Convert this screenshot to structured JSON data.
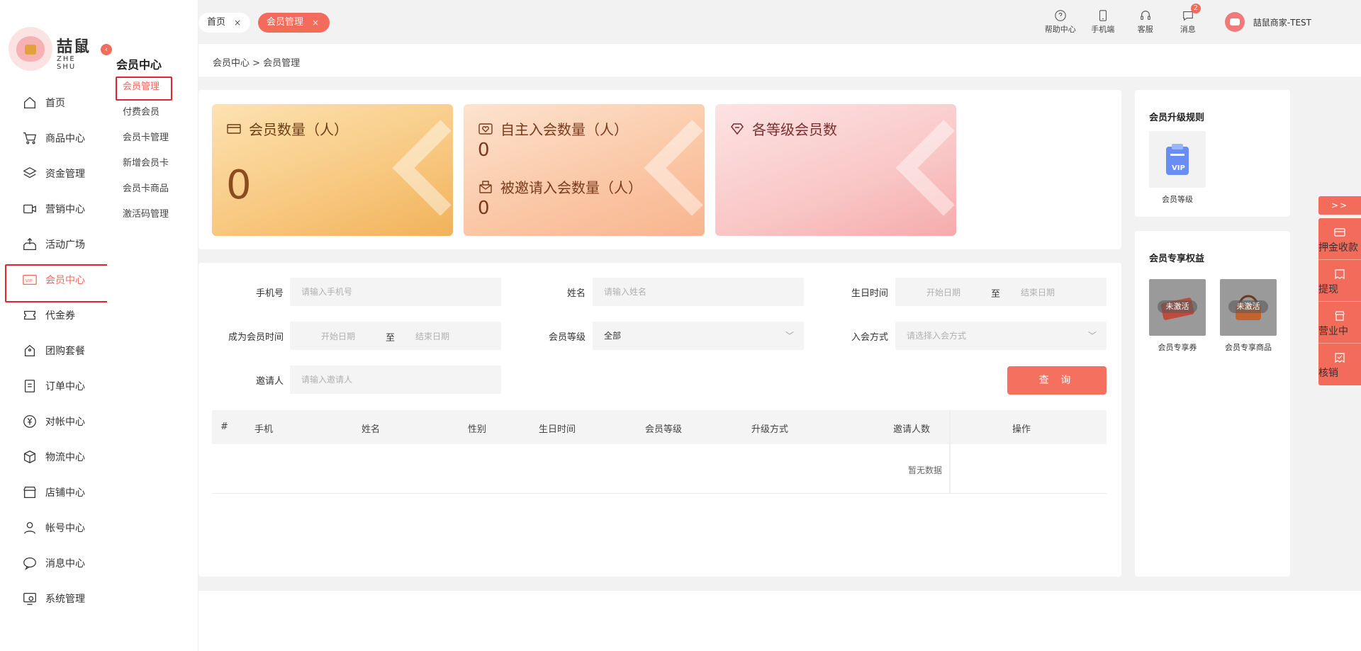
{
  "brand": {
    "logo_text": "喆鼠",
    "logo_sub": "ZHE SHU"
  },
  "nav": [
    {
      "label": "首页",
      "icon": "home-icon"
    },
    {
      "label": "商品中心",
      "icon": "cart-icon"
    },
    {
      "label": "资金管理",
      "icon": "layers-icon"
    },
    {
      "label": "营销中心",
      "icon": "marketing-icon"
    },
    {
      "label": "活动广场",
      "icon": "upload-box-icon"
    },
    {
      "label": "会员中心",
      "icon": "vip-icon"
    },
    {
      "label": "代金券",
      "icon": "coupon-icon"
    },
    {
      "label": "团购套餐",
      "icon": "bag-icon"
    },
    {
      "label": "订单中心",
      "icon": "order-icon"
    },
    {
      "label": "对帐中心",
      "icon": "yen-icon"
    },
    {
      "label": "物流中心",
      "icon": "box-icon"
    },
    {
      "label": "店铺中心",
      "icon": "store-icon"
    },
    {
      "label": "帐号中心",
      "icon": "user-icon"
    },
    {
      "label": "消息中心",
      "icon": "message-icon"
    },
    {
      "label": "系统管理",
      "icon": "settings-icon"
    }
  ],
  "subnav": {
    "title": "会员中心",
    "items": [
      "会员管理",
      "付费会员",
      "会员卡管理",
      "新增会员卡",
      "会员卡商品",
      "激活码管理"
    ]
  },
  "tabs": {
    "home": "首页",
    "member": "会员管理",
    "close": "×"
  },
  "tools": {
    "help": "帮助中心",
    "mobile": "手机端",
    "service": "客服",
    "message": "消息",
    "message_badge": "2",
    "user": "喆鼠商家-TEST"
  },
  "breadcrumb": "会员中心  > 会员管理",
  "stats": {
    "card1": {
      "title": "会员数量（人）",
      "value": "0"
    },
    "card2": {
      "title": "自主入会数量（人）",
      "value": "0",
      "title2": "被邀请入会数量（人）",
      "value2": "0"
    },
    "card3": {
      "title": "各等级会员数"
    }
  },
  "form": {
    "phone_label": "手机号",
    "phone_placeholder": "请输入手机号",
    "name_label": "姓名",
    "name_placeholder": "请输入姓名",
    "birthday_label": "生日时间",
    "start_date": "开始日期",
    "to": "至",
    "end_date": "结束日期",
    "join_time_label": "成为会员时间",
    "level_label": "会员等级",
    "level_value": "全部",
    "join_method_label": "入会方式",
    "join_method_placeholder": "请选择入会方式",
    "inviter_label": "邀请人",
    "inviter_placeholder": "请输入邀请人",
    "query_button": "查 询"
  },
  "table": {
    "columns": [
      "#",
      "手机",
      "姓名",
      "性别",
      "生日时间",
      "会员等级",
      "升级方式",
      "邀请人数",
      "操作"
    ],
    "empty_text": "暂无数据"
  },
  "upgrade_rules": {
    "title": "会员升级规则",
    "items": [
      {
        "label": "会员等级"
      }
    ]
  },
  "benefits": {
    "title": "会员专享权益",
    "items": [
      {
        "label": "会员专享券",
        "status": "未激活"
      },
      {
        "label": "会员专享商品",
        "status": "未激活"
      }
    ]
  },
  "float_bar": {
    "arrow": ">>",
    "items": [
      "押金收款",
      "提现",
      "营业中",
      "核销"
    ]
  },
  "colors": {
    "accent": "#f26b5b",
    "highlight_border": "#e5232f"
  }
}
